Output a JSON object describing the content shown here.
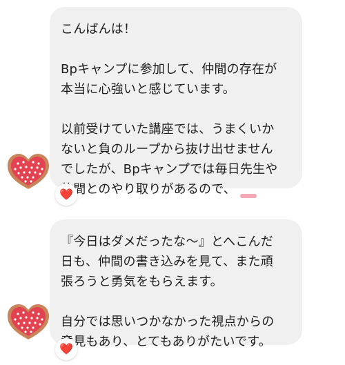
{
  "messages": [
    {
      "paragraphs": [
        {
          "lines": [
            "こんばんは！"
          ]
        },
        {
          "lines": [
            "Bpキャンプに参加して、仲間の存在が",
            "本当に心強いと感じています。"
          ]
        },
        {
          "lines": [
            "以前受けていた講座では、うまくいか",
            "ないと負のループから抜け出せません",
            "でしたが、Bpキャンプでは毎日先生や",
            "仲間とのやり取りがあるので、"
          ]
        }
      ],
      "reaction": "❤️"
    },
    {
      "paragraphs": [
        {
          "lines": [
            "『今日はダメだったな〜』とへこんだ",
            "日も、仲間の書き込みを見て、また頑",
            "張ろうと勇気をもらえます。"
          ]
        },
        {
          "lines": [
            "自分では思いつかなかった視点からの",
            "意見もあり、とてもありがたいです。"
          ]
        }
      ],
      "reaction": "❤️"
    }
  ],
  "colors": {
    "bubble": "#f0f0f0",
    "text": "#1f1f1f",
    "heart": "#e0202c",
    "avatar_heart": "#e34350",
    "avatar_border": "#c9855a"
  },
  "icons": {
    "avatar": "heart-cookie-icon",
    "reaction": "heart-icon"
  }
}
